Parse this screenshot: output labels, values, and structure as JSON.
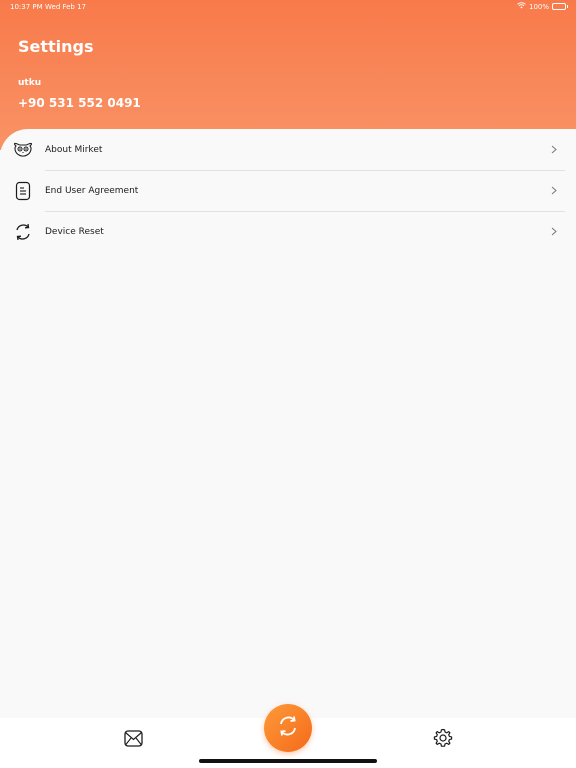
{
  "status_bar": {
    "time": "10:37 PM",
    "date": "Wed Feb 17",
    "battery": "100%",
    "icons": [
      "wifi-icon",
      "battery-icon"
    ]
  },
  "header": {
    "title": "Settings",
    "user_name": "utku",
    "user_phone": "+90 531 552 0491"
  },
  "menu": {
    "items": [
      {
        "label": "About Mirket",
        "icon": "mirket-face-icon"
      },
      {
        "label": "End User Agreement",
        "icon": "document-icon"
      },
      {
        "label": "Device Reset",
        "icon": "reset-icon"
      }
    ]
  },
  "tabbar": {
    "items": [
      "mail-icon",
      "sync-icon",
      "gear-icon"
    ]
  },
  "colors": {
    "header_top": "#f87a4a",
    "header_bottom": "#f99366",
    "accent": "#f56a1a",
    "background": "#f9f9f9"
  }
}
